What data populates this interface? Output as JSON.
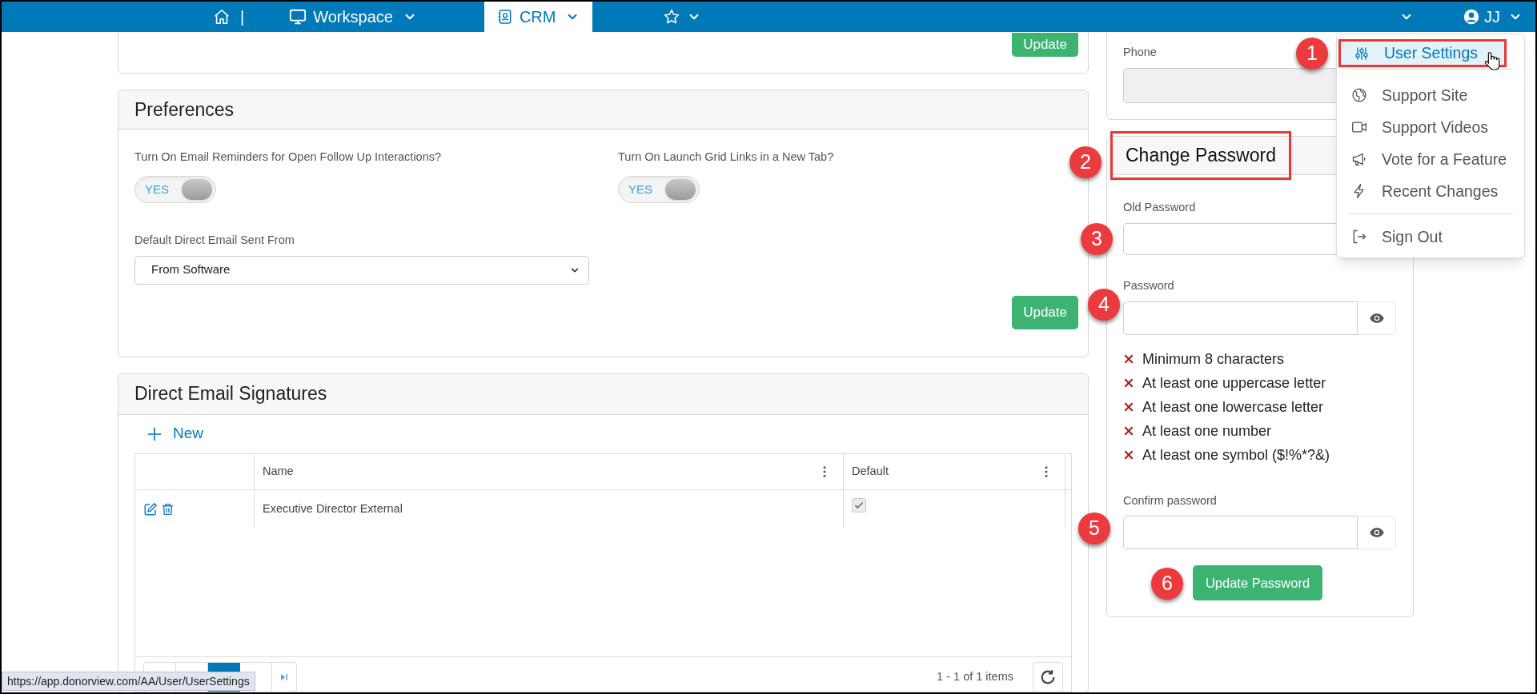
{
  "top_nav": {
    "items": [
      {
        "kind": "home",
        "separator": "|",
        "selected": false
      },
      {
        "kind": "workspace",
        "label": "Workspace",
        "selected": false
      },
      {
        "kind": "crm",
        "label": "CRM",
        "selected": true
      },
      {
        "kind": "favorites",
        "selected": false
      }
    ],
    "user": {
      "initials": "JJ"
    }
  },
  "contact_card": {
    "update_button": "Update"
  },
  "preferences": {
    "title": "Preferences",
    "toggles": [
      {
        "label": "Turn On Email Reminders for Open Follow Up Interactions?",
        "text": "YES",
        "on": true
      },
      {
        "label": "Turn On Launch Grid Links in a New Tab?",
        "text": "YES",
        "on": true
      }
    ],
    "select": {
      "label": "Default Direct Email Sent From",
      "value": "From Software"
    },
    "update_button": "Update"
  },
  "signatures": {
    "title": "Direct Email Signatures",
    "new_button": "New",
    "columns": [
      {
        "label": "Name"
      },
      {
        "label": "Default"
      }
    ],
    "rows": [
      {
        "name": "Executive Director External",
        "default": true
      }
    ],
    "pager": {
      "pages": [
        {
          "selected": true
        }
      ],
      "info": "1 - 1 of 1 items"
    }
  },
  "phone_card": {
    "label": "Phone",
    "disabled": true
  },
  "change_password": {
    "title": "Change Password",
    "callout": true,
    "fields": [
      {
        "label": "Old Password",
        "reveal": false
      },
      {
        "label": "Password",
        "reveal": true
      }
    ],
    "requirements": [
      {
        "text": "Minimum 8 characters",
        "met": false
      },
      {
        "text": "At least one uppercase letter",
        "met": false
      },
      {
        "text": "At least one lowercase letter",
        "met": false
      },
      {
        "text": "At least one number",
        "met": false
      },
      {
        "text": "At least one symbol ($!%*?&)",
        "met": false
      }
    ],
    "confirm_field": {
      "label": "Confirm password",
      "reveal": true
    },
    "submit": "Update Password"
  },
  "user_menu": {
    "items": [
      {
        "kind": "settings",
        "label": "User Settings",
        "selected": true,
        "callout": true,
        "divider_after": true
      },
      {
        "kind": "globe",
        "label": "Support Site",
        "selected": false,
        "callout": false,
        "divider_after": false
      },
      {
        "kind": "video",
        "label": "Support Videos",
        "selected": false,
        "callout": false,
        "divider_after": false
      },
      {
        "kind": "megaphone",
        "label": "Vote for a Feature",
        "selected": false,
        "callout": false,
        "divider_after": false
      },
      {
        "kind": "bolt",
        "label": "Recent Changes",
        "selected": false,
        "callout": false,
        "divider_after": true
      },
      {
        "kind": "signout",
        "label": "Sign Out",
        "selected": false,
        "callout": false,
        "divider_after": false
      }
    ]
  },
  "annotations": [
    {
      "label": "1"
    },
    {
      "label": "2"
    },
    {
      "label": "3"
    },
    {
      "label": "4"
    },
    {
      "label": "5"
    },
    {
      "label": "6"
    }
  ],
  "status_url": "https://app.donorview.com/AA/User/UserSettings"
}
